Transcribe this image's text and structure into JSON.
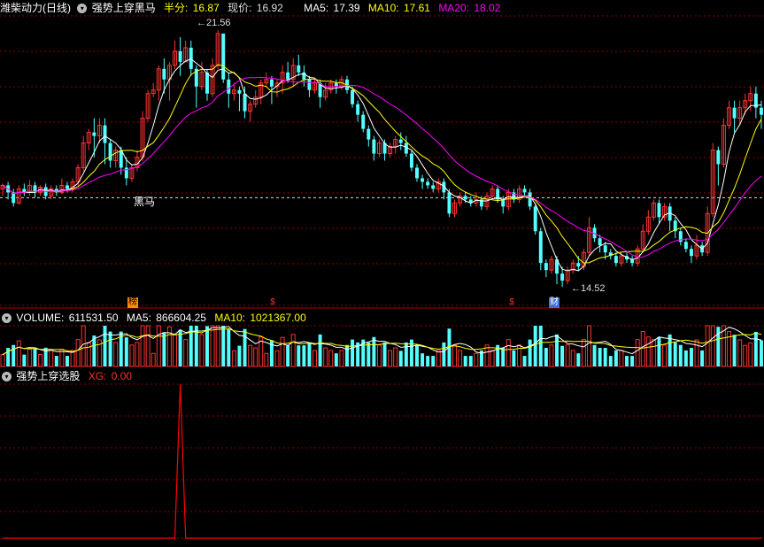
{
  "header": {
    "stock_name": "潍柴动力(日线)",
    "indicator_name": "强势上穿黑马",
    "half_label": "半分:",
    "half_value": "16.87",
    "price_label": "现价:",
    "price_value": "16.92",
    "ma5_label": "MA5:",
    "ma5_value": "17.39",
    "ma10_label": "MA10:",
    "ma10_value": "17.61",
    "ma20_label": "MA20:",
    "ma20_value": "18.02"
  },
  "volume_header": {
    "label": "VOLUME:",
    "value": "611531.50",
    "ma5_label": "MA5:",
    "ma5_value": "866604.25",
    "ma10_label": "MA10:",
    "ma10_value": "1021367.00"
  },
  "indicator_header": {
    "name": "强势上穿选股",
    "xg_label": "XG:",
    "xg_value": "0.00"
  },
  "annotations": {
    "high_label": "21.56",
    "low_label": "14.52",
    "heima_label": "黑马",
    "tag_bang": "榜",
    "tag_dollar1": "$",
    "tag_dollar2": "$",
    "tag_cai": "财"
  },
  "icons": [
    "dropdown-icon"
  ],
  "colors": {
    "up": "#ff3232",
    "down": "#54ffff",
    "ma5": "#ffffff",
    "ma10": "#ffff00",
    "ma20": "#ff00ff",
    "grid": "#8b0000",
    "xg": "#ff0000"
  },
  "chart_data": {
    "type": "candlestick",
    "price_axis": [
      14.0,
      22.2
    ],
    "candles": [
      [
        17.3,
        17.4,
        17.1,
        17.45
      ],
      [
        17.4,
        17.2,
        17.0,
        17.5
      ],
      [
        17.2,
        16.9,
        16.8,
        17.3
      ],
      [
        16.9,
        17.3,
        16.85,
        17.4
      ],
      [
        17.3,
        17.2,
        17.1,
        17.45
      ],
      [
        17.2,
        17.4,
        17.1,
        17.55
      ],
      [
        17.4,
        17.2,
        17.05,
        17.5
      ],
      [
        17.2,
        17.35,
        17.1,
        17.4
      ],
      [
        17.35,
        17.1,
        17.0,
        17.45
      ],
      [
        17.1,
        17.3,
        17.0,
        17.4
      ],
      [
        17.3,
        17.2,
        17.1,
        17.4
      ],
      [
        17.2,
        17.4,
        17.15,
        17.6
      ],
      [
        17.4,
        17.3,
        17.2,
        17.5
      ],
      [
        17.3,
        17.5,
        17.2,
        17.6
      ],
      [
        17.5,
        17.9,
        17.4,
        18.0
      ],
      [
        17.9,
        18.6,
        17.8,
        18.8
      ],
      [
        18.6,
        18.9,
        18.4,
        19.0
      ],
      [
        18.9,
        18.8,
        18.2,
        19.3
      ],
      [
        18.8,
        19.1,
        18.6,
        19.3
      ],
      [
        19.1,
        18.6,
        18.0,
        19.3
      ],
      [
        18.6,
        18.1,
        17.9,
        18.7
      ],
      [
        18.1,
        18.4,
        17.9,
        18.5
      ],
      [
        18.4,
        17.9,
        17.7,
        18.5
      ],
      [
        17.9,
        17.6,
        17.4,
        18.2
      ],
      [
        17.6,
        17.9,
        17.5,
        18.0
      ],
      [
        17.9,
        18.2,
        17.8,
        18.4
      ],
      [
        18.2,
        19.3,
        18.1,
        19.5
      ],
      [
        19.3,
        20.0,
        19.2,
        20.1
      ],
      [
        20.0,
        20.1,
        19.9,
        20.3
      ],
      [
        20.1,
        20.7,
        19.8,
        20.8
      ],
      [
        20.7,
        20.4,
        20.0,
        21.0
      ],
      [
        20.4,
        20.8,
        19.8,
        20.9
      ],
      [
        20.8,
        21.2,
        20.7,
        21.5
      ],
      [
        21.2,
        20.9,
        20.5,
        21.6
      ],
      [
        20.9,
        21.3,
        20.9,
        21.5
      ],
      [
        21.3,
        20.7,
        20.5,
        21.5
      ],
      [
        20.7,
        20.2,
        19.6,
        20.8
      ],
      [
        20.2,
        20.6,
        20.1,
        20.9
      ],
      [
        20.6,
        20.0,
        19.8,
        20.7
      ],
      [
        20.0,
        20.8,
        19.9,
        21.0
      ],
      [
        20.8,
        21.7,
        20.7,
        21.8
      ],
      [
        21.7,
        20.4,
        20.3,
        21.7
      ],
      [
        20.4,
        20.0,
        19.6,
        20.6
      ],
      [
        20.0,
        20.1,
        19.8,
        20.3
      ],
      [
        20.1,
        20.0,
        19.5,
        20.2
      ],
      [
        20.0,
        19.5,
        19.3,
        20.2
      ],
      [
        19.5,
        19.7,
        19.2,
        19.8
      ],
      [
        19.7,
        19.9,
        19.6,
        20.1
      ],
      [
        19.9,
        20.3,
        19.7,
        20.4
      ],
      [
        20.3,
        20.4,
        20.2,
        20.6
      ],
      [
        20.4,
        20.2,
        19.7,
        20.5
      ],
      [
        20.2,
        20.3,
        19.9,
        20.4
      ],
      [
        20.3,
        20.6,
        20.0,
        20.8
      ],
      [
        20.6,
        20.4,
        20.3,
        20.9
      ],
      [
        20.4,
        20.8,
        20.2,
        21.0
      ],
      [
        20.8,
        20.6,
        20.5,
        21.1
      ],
      [
        20.6,
        20.4,
        20.2,
        20.8
      ],
      [
        20.4,
        20.1,
        19.9,
        20.5
      ],
      [
        20.1,
        20.3,
        20.0,
        20.4
      ],
      [
        20.3,
        19.9,
        19.6,
        20.4
      ],
      [
        19.9,
        20.1,
        19.8,
        20.3
      ],
      [
        20.1,
        20.3,
        20.0,
        20.4
      ],
      [
        20.3,
        20.2,
        20.0,
        20.4
      ],
      [
        20.2,
        20.4,
        20.1,
        20.5
      ],
      [
        20.4,
        20.1,
        20.0,
        20.5
      ],
      [
        20.1,
        19.7,
        19.6,
        20.2
      ],
      [
        19.7,
        19.4,
        19.2,
        19.8
      ],
      [
        19.4,
        19.0,
        18.9,
        19.5
      ],
      [
        19.0,
        18.7,
        18.5,
        19.1
      ],
      [
        18.7,
        18.3,
        18.1,
        18.8
      ],
      [
        18.3,
        18.6,
        18.2,
        18.7
      ],
      [
        18.6,
        18.3,
        18.1,
        18.7
      ],
      [
        18.3,
        18.5,
        18.2,
        18.6
      ],
      [
        18.5,
        18.7,
        18.3,
        18.8
      ],
      [
        18.7,
        18.6,
        18.4,
        18.9
      ],
      [
        18.6,
        18.3,
        18.2,
        18.8
      ],
      [
        18.3,
        17.9,
        17.8,
        18.4
      ],
      [
        17.9,
        17.6,
        17.5,
        18.0
      ],
      [
        17.6,
        17.5,
        17.3,
        17.7
      ],
      [
        17.5,
        17.4,
        17.3,
        17.6
      ],
      [
        17.4,
        17.3,
        17.2,
        17.5
      ],
      [
        17.3,
        17.5,
        17.2,
        17.6
      ],
      [
        17.5,
        17.2,
        17.0,
        17.6
      ],
      [
        17.2,
        16.6,
        16.5,
        17.3
      ],
      [
        16.6,
        16.9,
        16.5,
        17.0
      ],
      [
        16.9,
        17.1,
        16.8,
        17.2
      ],
      [
        17.1,
        17.0,
        16.9,
        17.2
      ],
      [
        17.0,
        16.9,
        16.8,
        17.1
      ],
      [
        16.9,
        17.0,
        16.8,
        17.2
      ],
      [
        17.0,
        16.8,
        16.7,
        17.1
      ],
      [
        16.8,
        17.1,
        16.7,
        17.2
      ],
      [
        17.1,
        17.3,
        17.0,
        17.4
      ],
      [
        17.3,
        17.0,
        16.9,
        17.4
      ],
      [
        17.0,
        16.8,
        16.6,
        17.1
      ],
      [
        16.8,
        17.2,
        16.7,
        17.3
      ],
      [
        17.2,
        17.0,
        16.9,
        17.3
      ],
      [
        17.0,
        17.3,
        16.9,
        17.4
      ],
      [
        17.3,
        17.2,
        17.1,
        17.4
      ],
      [
        17.2,
        16.8,
        16.7,
        17.3
      ],
      [
        16.8,
        16.1,
        16.0,
        16.9
      ],
      [
        16.1,
        15.2,
        15.0,
        16.2
      ],
      [
        15.2,
        15.0,
        14.8,
        15.3
      ],
      [
        15.0,
        15.3,
        14.9,
        15.4
      ],
      [
        15.3,
        14.9,
        14.6,
        15.4
      ],
      [
        14.9,
        14.7,
        14.52,
        15.1
      ],
      [
        14.7,
        15.0,
        14.6,
        15.1
      ],
      [
        15.0,
        15.2,
        14.9,
        15.3
      ],
      [
        15.2,
        15.1,
        15.0,
        15.4
      ],
      [
        15.1,
        15.5,
        15.0,
        15.6
      ],
      [
        15.5,
        16.2,
        15.4,
        16.5
      ],
      [
        16.2,
        15.9,
        15.8,
        16.3
      ],
      [
        15.9,
        15.7,
        15.5,
        16.0
      ],
      [
        15.7,
        15.5,
        15.3,
        15.8
      ],
      [
        15.5,
        15.4,
        15.3,
        15.6
      ],
      [
        15.4,
        15.2,
        15.1,
        15.5
      ],
      [
        15.2,
        15.4,
        15.1,
        15.5
      ],
      [
        15.4,
        15.3,
        15.2,
        15.5
      ],
      [
        15.3,
        15.2,
        15.1,
        15.4
      ],
      [
        15.2,
        15.6,
        15.1,
        15.7
      ],
      [
        15.6,
        16.1,
        15.5,
        16.3
      ],
      [
        16.1,
        16.5,
        16.0,
        16.7
      ],
      [
        16.5,
        16.9,
        16.4,
        17.0
      ],
      [
        16.9,
        16.5,
        16.3,
        17.0
      ],
      [
        16.5,
        16.8,
        16.4,
        16.9
      ],
      [
        16.8,
        16.4,
        16.1,
        16.9
      ],
      [
        16.4,
        16.1,
        15.9,
        16.5
      ],
      [
        16.1,
        15.8,
        15.7,
        16.2
      ],
      [
        15.8,
        15.6,
        15.5,
        15.9
      ],
      [
        15.6,
        15.4,
        15.2,
        15.7
      ],
      [
        15.4,
        15.7,
        15.3,
        16.0
      ],
      [
        15.7,
        15.5,
        15.4,
        15.8
      ],
      [
        15.5,
        16.6,
        15.4,
        16.8
      ],
      [
        16.6,
        18.4,
        16.5,
        18.6
      ],
      [
        18.4,
        18.0,
        17.4,
        18.5
      ],
      [
        18.0,
        19.1,
        17.9,
        19.3
      ],
      [
        19.1,
        19.6,
        19.0,
        19.8
      ],
      [
        19.6,
        19.3,
        18.9,
        19.8
      ],
      [
        19.3,
        19.6,
        19.1,
        19.8
      ],
      [
        19.6,
        19.8,
        19.4,
        20.0
      ],
      [
        19.8,
        20.0,
        19.5,
        20.2
      ],
      [
        20.0,
        19.6,
        19.3,
        20.2
      ],
      [
        19.6,
        19.4,
        19.0,
        19.8
      ]
    ],
    "volume_axis_max": 1.0,
    "xg_signal_index": 33
  }
}
